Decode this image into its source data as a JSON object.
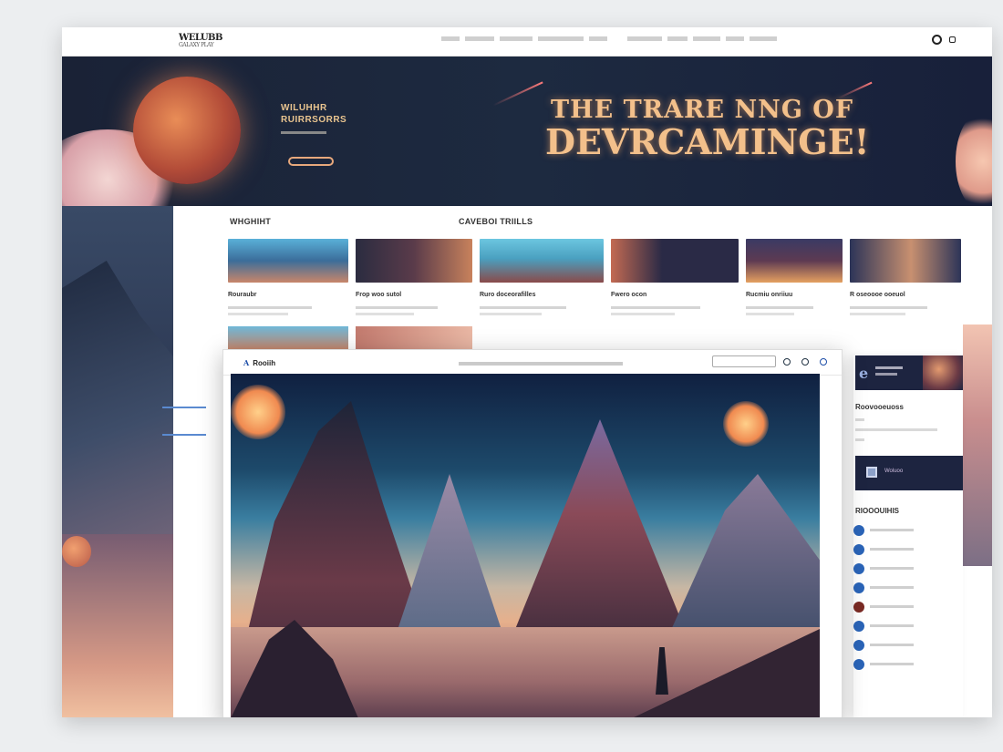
{
  "header": {
    "logo_top": "WELUBB",
    "logo_sub": "GALAXY PLAY",
    "nav": [
      "",
      "",
      "",
      "",
      "",
      "",
      "",
      "",
      "",
      ""
    ],
    "icons": [
      "search-icon",
      "user-icon"
    ]
  },
  "hero": {
    "small_line1": "WILUHHR",
    "small_line2": "RUIRRSORRS",
    "title_line1": "THE TRARE  NNG OF",
    "title_line2": "DEVRCAMINGE!"
  },
  "sections": {
    "left_label": "WHGHIHT",
    "cards_label": "CAVEBOI TRIILLS"
  },
  "cards": [
    {
      "title": "Rouraubr",
      "color": "#3b6d9a"
    },
    {
      "title": "Frop woo sutol",
      "color": "#2b2c40"
    },
    {
      "title": "Ruro doceorafilles",
      "color": "#4aa0c0"
    },
    {
      "title": "Fwero ocon",
      "color": "#2a2a46"
    },
    {
      "title": "Rucmiu onriiuu",
      "color": "#5d3a52"
    },
    {
      "title": "R oseoooe ooeuol",
      "color": "#2c3458"
    }
  ],
  "browser": {
    "brand_mark": "A",
    "brand": "Rooiih",
    "icons": [
      "search-icon",
      "info-icon",
      "user-icon"
    ]
  },
  "sidebar": {
    "top_letter": "e",
    "heading1": "Roovooeuoss",
    "promo_text": "Woluoo",
    "heading2": "RIOOOUIHIS",
    "dot_colors": [
      "#2a64b8",
      "#2a64b8",
      "#2a64b8",
      "#2a64b8",
      "#7a2a24",
      "#2a64b8",
      "#2a64b8",
      "#2a64b8"
    ]
  },
  "colors": {
    "hero_bg": "#1d2a40",
    "accent_orange": "#f3c08b",
    "brand_blue": "#1d4ea8",
    "dark_navy": "#1d2440"
  }
}
